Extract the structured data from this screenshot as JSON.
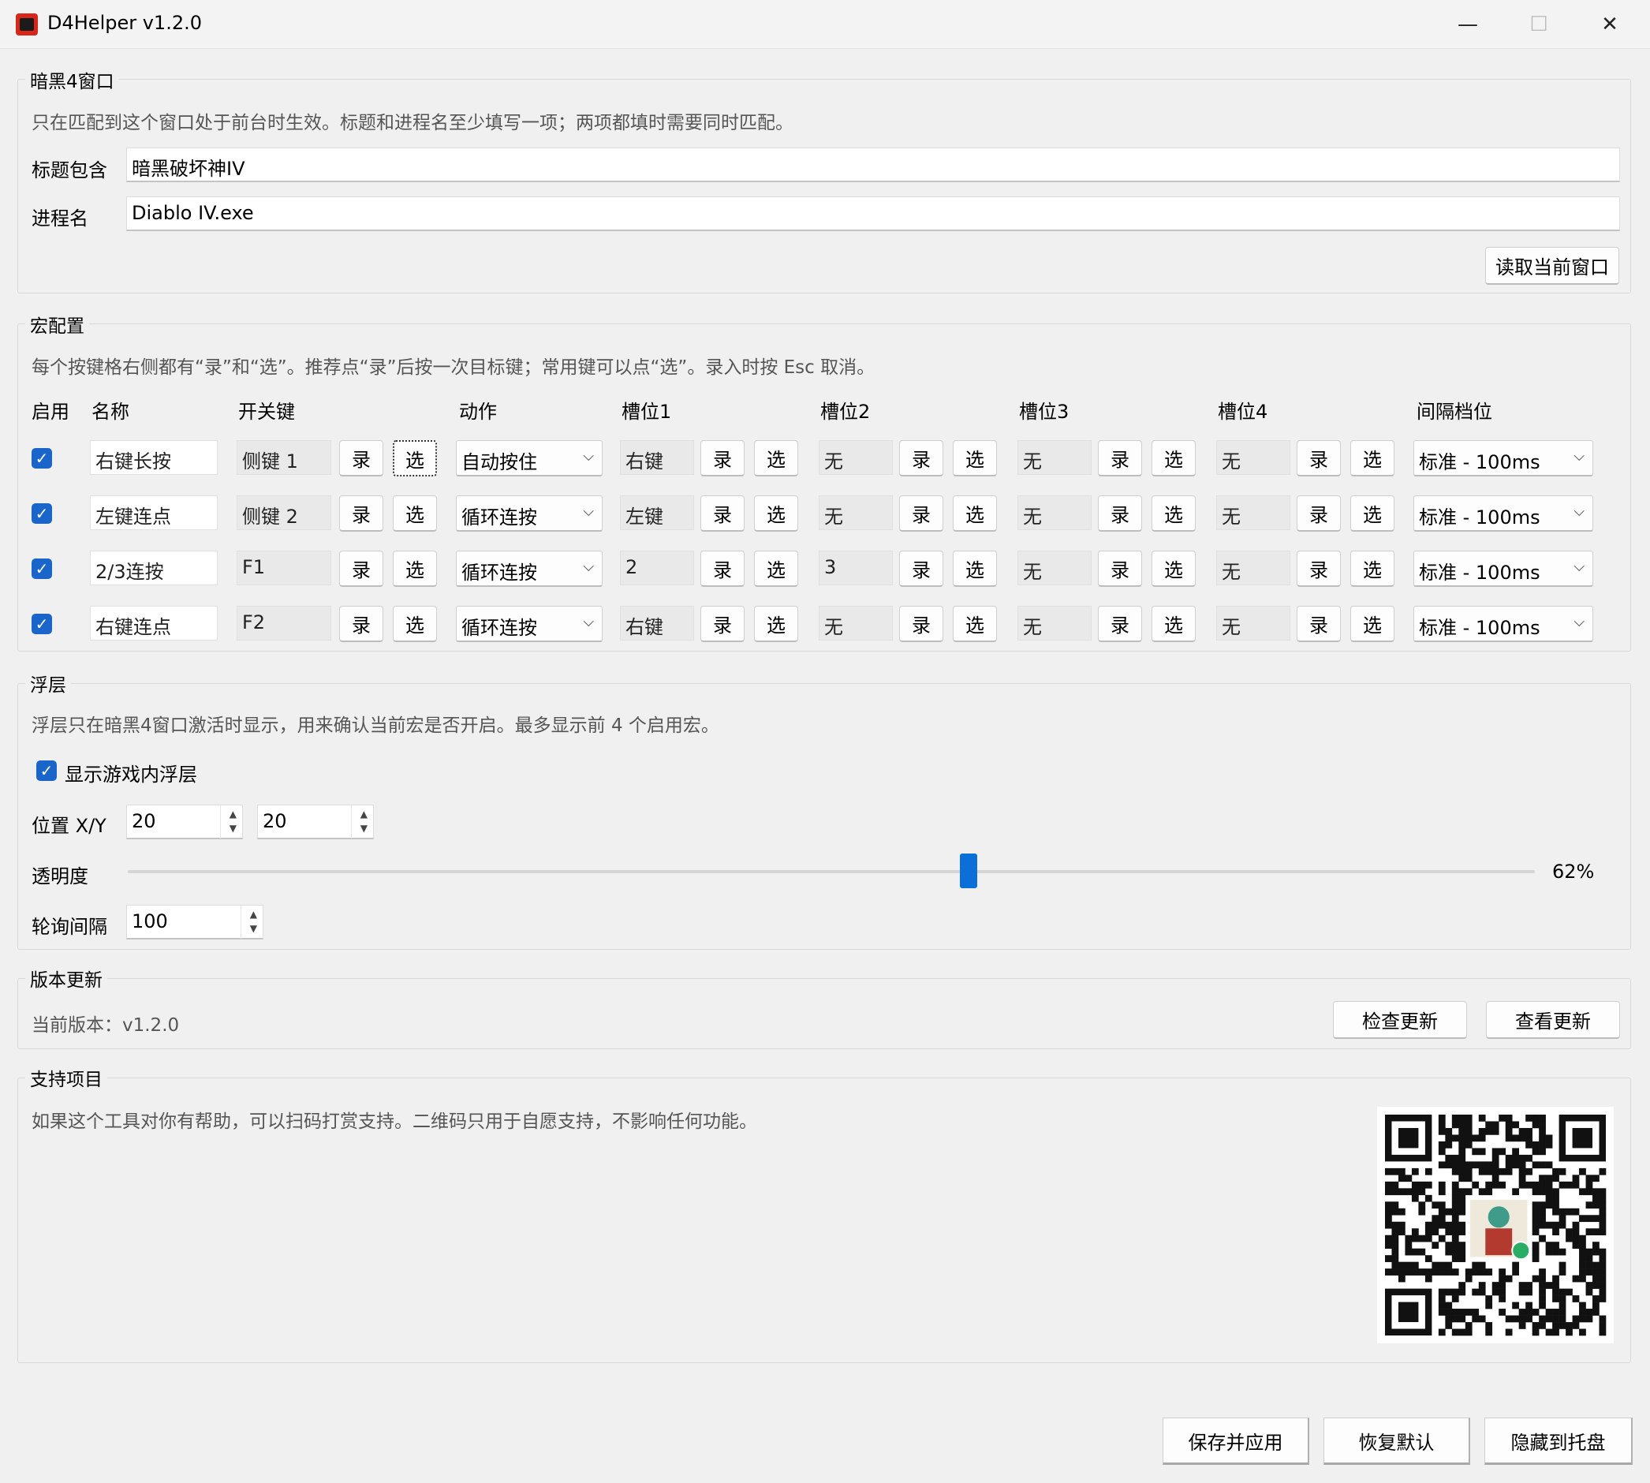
{
  "window": {
    "title": "D4Helper v1.2.0",
    "minimize": "—",
    "maximize": "☐",
    "close": "✕"
  },
  "target": {
    "group_title": "暗黑4窗口",
    "hint": "只在匹配到这个窗口处于前台时生效。标题和进程名至少填写一项；两项都填时需要同时匹配。",
    "title_label": "标题包含",
    "title_value": "暗黑破坏神IV",
    "process_label": "进程名",
    "process_value": "Diablo IV.exe",
    "read_button": "读取当前窗口"
  },
  "macros": {
    "group_title": "宏配置",
    "hint": "每个按键格右侧都有“录”和“选”。推荐点“录”后按一次目标键；常用键可以点“选”。录入时按 Esc 取消。",
    "headers": {
      "enable": "启用",
      "name": "名称",
      "hotkey": "开关键",
      "action": "动作",
      "slot1": "槽位1",
      "slot2": "槽位2",
      "slot3": "槽位3",
      "slot4": "槽位4",
      "interval": "间隔档位"
    },
    "record_label": "录",
    "select_label": "选",
    "rows": [
      {
        "enabled": true,
        "name": "右键长按",
        "hotkey": "侧键 1",
        "action": "自动按住",
        "slot1": "右键",
        "slot2": "无",
        "slot3": "无",
        "slot4": "无",
        "interval": "标准 - 100ms"
      },
      {
        "enabled": true,
        "name": "左键连点",
        "hotkey": "侧键 2",
        "action": "循环连按",
        "slot1": "左键",
        "slot2": "无",
        "slot3": "无",
        "slot4": "无",
        "interval": "标准 - 100ms"
      },
      {
        "enabled": true,
        "name": "2/3连按",
        "hotkey": "F1",
        "action": "循环连按",
        "slot1": "2",
        "slot2": "3",
        "slot3": "无",
        "slot4": "无",
        "interval": "标准 - 100ms"
      },
      {
        "enabled": true,
        "name": "右键连点",
        "hotkey": "F2",
        "action": "循环连按",
        "slot1": "右键",
        "slot2": "无",
        "slot3": "无",
        "slot4": "无",
        "interval": "标准 - 100ms"
      }
    ]
  },
  "overlay": {
    "group_title": "浮层",
    "hint": "浮层只在暗黑4窗口激活时显示，用来确认当前宏是否开启。最多显示前 4 个启用宏。",
    "show_label": "显示游戏内浮层",
    "show_checked": true,
    "position_label": "位置 X/Y",
    "x_value": "20",
    "y_value": "20",
    "opacity_label": "透明度",
    "opacity_value": 0.62,
    "opacity_text": "62%",
    "poll_label": "轮询间隔",
    "poll_value": "100"
  },
  "update": {
    "group_title": "版本更新",
    "current_version": "当前版本：v1.2.0",
    "check_button": "检查更新",
    "view_button": "查看更新"
  },
  "support": {
    "group_title": "支持项目",
    "hint": "如果这个工具对你有帮助，可以扫码打赏支持。二维码只用于自愿支持，不影响任何功能。"
  },
  "footer": {
    "save_button": "保存并应用",
    "reset_button": "恢复默认",
    "tray_button": "隐藏到托盘"
  },
  "colors": {
    "accent": "#1a65c9",
    "background": "#f0f0f0",
    "wechat_green": "#2aae67"
  }
}
